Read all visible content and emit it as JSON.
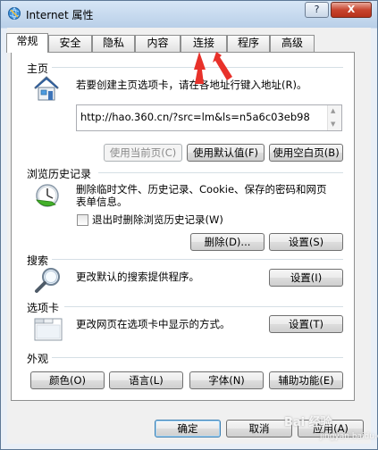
{
  "window": {
    "title": "Internet 属性",
    "help_label": "?",
    "close_label": "X"
  },
  "tabs": [
    {
      "label": "常规",
      "active": true
    },
    {
      "label": "安全"
    },
    {
      "label": "隐私"
    },
    {
      "label": "内容"
    },
    {
      "label": "连接"
    },
    {
      "label": "程序"
    },
    {
      "label": "高级"
    }
  ],
  "home": {
    "title": "主页",
    "description": "若要创建主页选项卡，请在各地址行键入地址(R)。",
    "url": "http://hao.360.cn/?src=lm&ls=n5a6c03eb98",
    "use_current": "使用当前页(C)",
    "use_default": "使用默认值(F)",
    "use_blank": "使用空白页(B)"
  },
  "history": {
    "title": "浏览历史记录",
    "description_line1": "删除临时文件、历史记录、Cookie、保存的密码和网页",
    "description_line2": "表单信息。",
    "checkbox_label": "退出时删除浏览历史记录(W)",
    "delete_button": "删除(D)...",
    "settings_button": "设置(S)"
  },
  "search": {
    "title": "搜索",
    "description": "更改默认的搜索提供程序。",
    "settings_button": "设置(I)"
  },
  "tabs_section": {
    "title": "选项卡",
    "description": "更改网页在选项卡中显示的方式。",
    "settings_button": "设置(T)"
  },
  "appearance": {
    "title": "外观",
    "colors_button": "颜色(O)",
    "languages_button": "语言(L)",
    "fonts_button": "字体(N)",
    "accessibility_button": "辅助功能(E)"
  },
  "footer": {
    "ok_button": "确定",
    "cancel_button": "取消",
    "apply_button": "应用(A)"
  },
  "watermark": {
    "text": "Bai 经验",
    "sub": "jingyan.baidu.com"
  },
  "colors": {
    "annotation_arrow": "#e8312a",
    "title_bar": "#c9dcf0",
    "close_button": "#c8452f"
  }
}
